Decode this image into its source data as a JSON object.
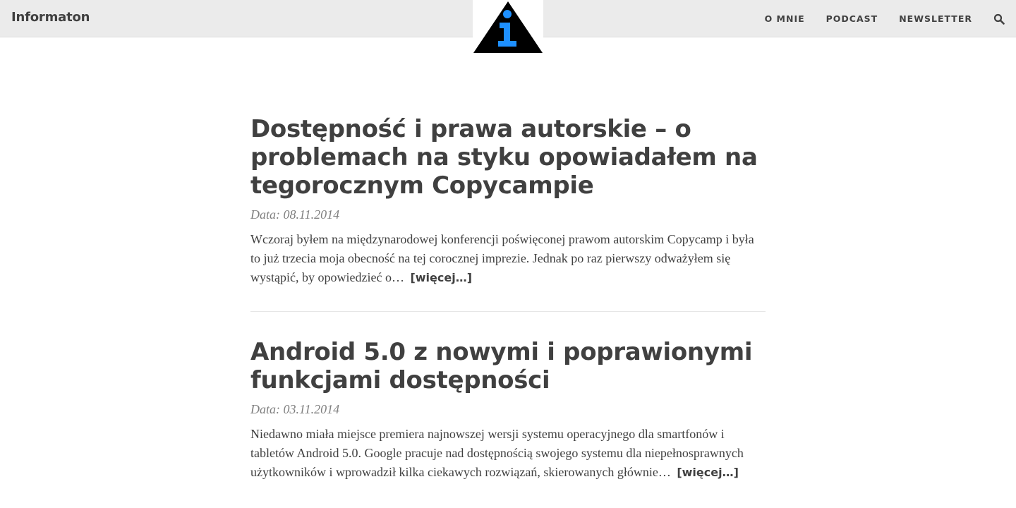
{
  "navbar": {
    "brand": "Informaton",
    "links": [
      {
        "label": "O MNIE"
      },
      {
        "label": "PODCAST"
      },
      {
        "label": "NEWSLETTER"
      }
    ],
    "search_icon": "search-icon",
    "logo_icon": "info-triangle-logo"
  },
  "posts": [
    {
      "title": "Dostępność i prawa autorskie – o problemach na styku opowiadałem na tegorocznym Copycampie",
      "date": "Data: 08.11.2014",
      "excerpt": "Wczoraj byłem na międzynarodowej konferencji poświęconej prawom autorskim Copycamp i była to już trzecia moja obecność na tej corocznej imprezie. Jednak po raz pierwszy odważyłem się wystąpić, by opowiedzieć o…",
      "more": "[więcej…]"
    },
    {
      "title": "Android 5.0 z nowymi i poprawionymi funkcjami dostępności",
      "date": "Data: 03.11.2014",
      "excerpt": "Niedawno miała miejsce premiera najnowszej wersji systemu operacyjnego dla smartfonów i tabletów Android 5.0. Google pracuje nad dostępnością swojego systemu dla niepełnosprawnych użytkowników i wprowadził kilka ciekawych rozwiązań, skierowanych głównie…",
      "more": "[więcej…]"
    }
  ],
  "colors": {
    "nav_bg": "#ebebeb",
    "text": "#404040",
    "muted": "#808080",
    "logo_accent": "#1e90ff"
  }
}
